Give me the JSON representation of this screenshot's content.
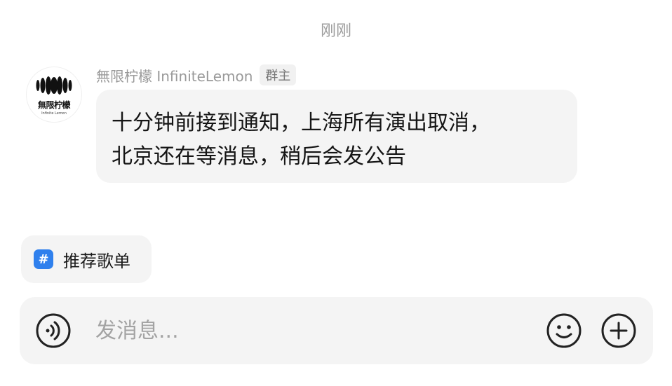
{
  "timestamp": "刚刚",
  "message": {
    "sender": "無限柠檬 InfiniteLemon",
    "role_badge": "群主",
    "avatar_text": "無限柠檬",
    "avatar_subtext": "Infinite Lemon",
    "text_line1": "十分钟前接到通知，上海所有演出取消，",
    "text_line2": "北京还在等消息，稍后会发公告"
  },
  "topic_chip": {
    "icon": "hash-icon",
    "label": "推荐歌单",
    "icon_color": "#2f80ed"
  },
  "composer": {
    "placeholder": "发消息...",
    "voice_icon": "voice-icon",
    "emoji_icon": "emoji-icon",
    "plus_icon": "plus-icon"
  }
}
